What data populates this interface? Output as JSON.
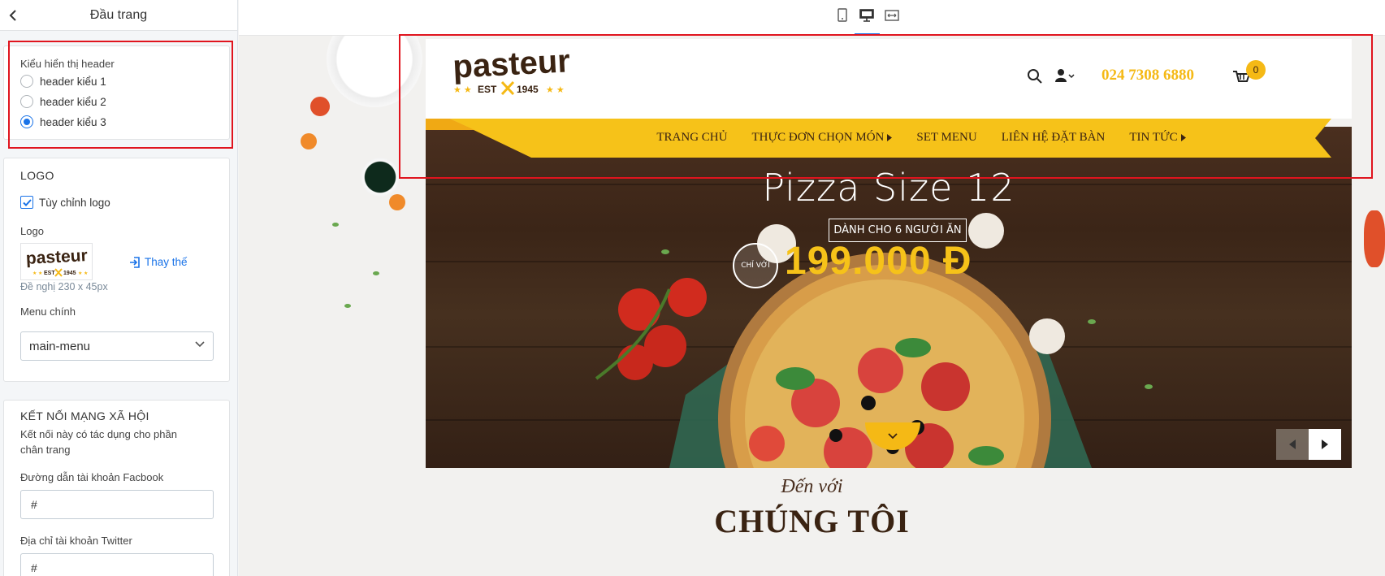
{
  "panel": {
    "title": "Đầu trang",
    "header_style": {
      "label": "Kiểu hiển thị header",
      "options": [
        "header kiểu 1",
        "header kiểu 2",
        "header kiểu 3"
      ],
      "selected_index": 2
    },
    "logo_section": {
      "title": "LOGO",
      "custom_logo_label": "Tùy chỉnh logo",
      "custom_logo_checked": true,
      "logo_label": "Logo",
      "replace_label": "Thay thế",
      "hint": "Đề nghị 230 x 45px",
      "menu_label": "Menu chính",
      "menu_value": "main-menu"
    },
    "social_section": {
      "title": "KẾT NỐI MẠNG XÃ HỘI",
      "description": "Kết nối này có tác dụng cho phần chân trang",
      "facebook_label": "Đường dẫn tài khoản Facbook",
      "facebook_value": "#",
      "twitter_label": "Địa chỉ tài khoản Twitter",
      "twitter_value": "#"
    }
  },
  "site": {
    "logo": {
      "name": "Pasteur",
      "est": "EST",
      "year": "1945"
    },
    "phone": "024 7308 6880",
    "cart_count": "0",
    "nav": [
      {
        "label": "TRANG CHỦ",
        "has_sub": false
      },
      {
        "label": "THỰC ĐƠN CHỌN MÓN",
        "has_sub": true
      },
      {
        "label": "SET MENU",
        "has_sub": false
      },
      {
        "label": "LIÊN HỆ ĐẶT BÀN",
        "has_sub": false
      },
      {
        "label": "TIN TỨC",
        "has_sub": true
      }
    ],
    "hero": {
      "title": "Pizza Size 12",
      "tag": "DÀNH CHO 6 NGƯỜI ĂN",
      "circle": "CHỈ VỚI",
      "price": "199.000 Đ"
    },
    "intro": {
      "sub": "Đến với",
      "title": "CHÚNG TÔI"
    }
  },
  "colors": {
    "accent": "#f5b915",
    "highlight": "#e0141e",
    "link": "#1a73e8",
    "brown": "#3a2312"
  }
}
